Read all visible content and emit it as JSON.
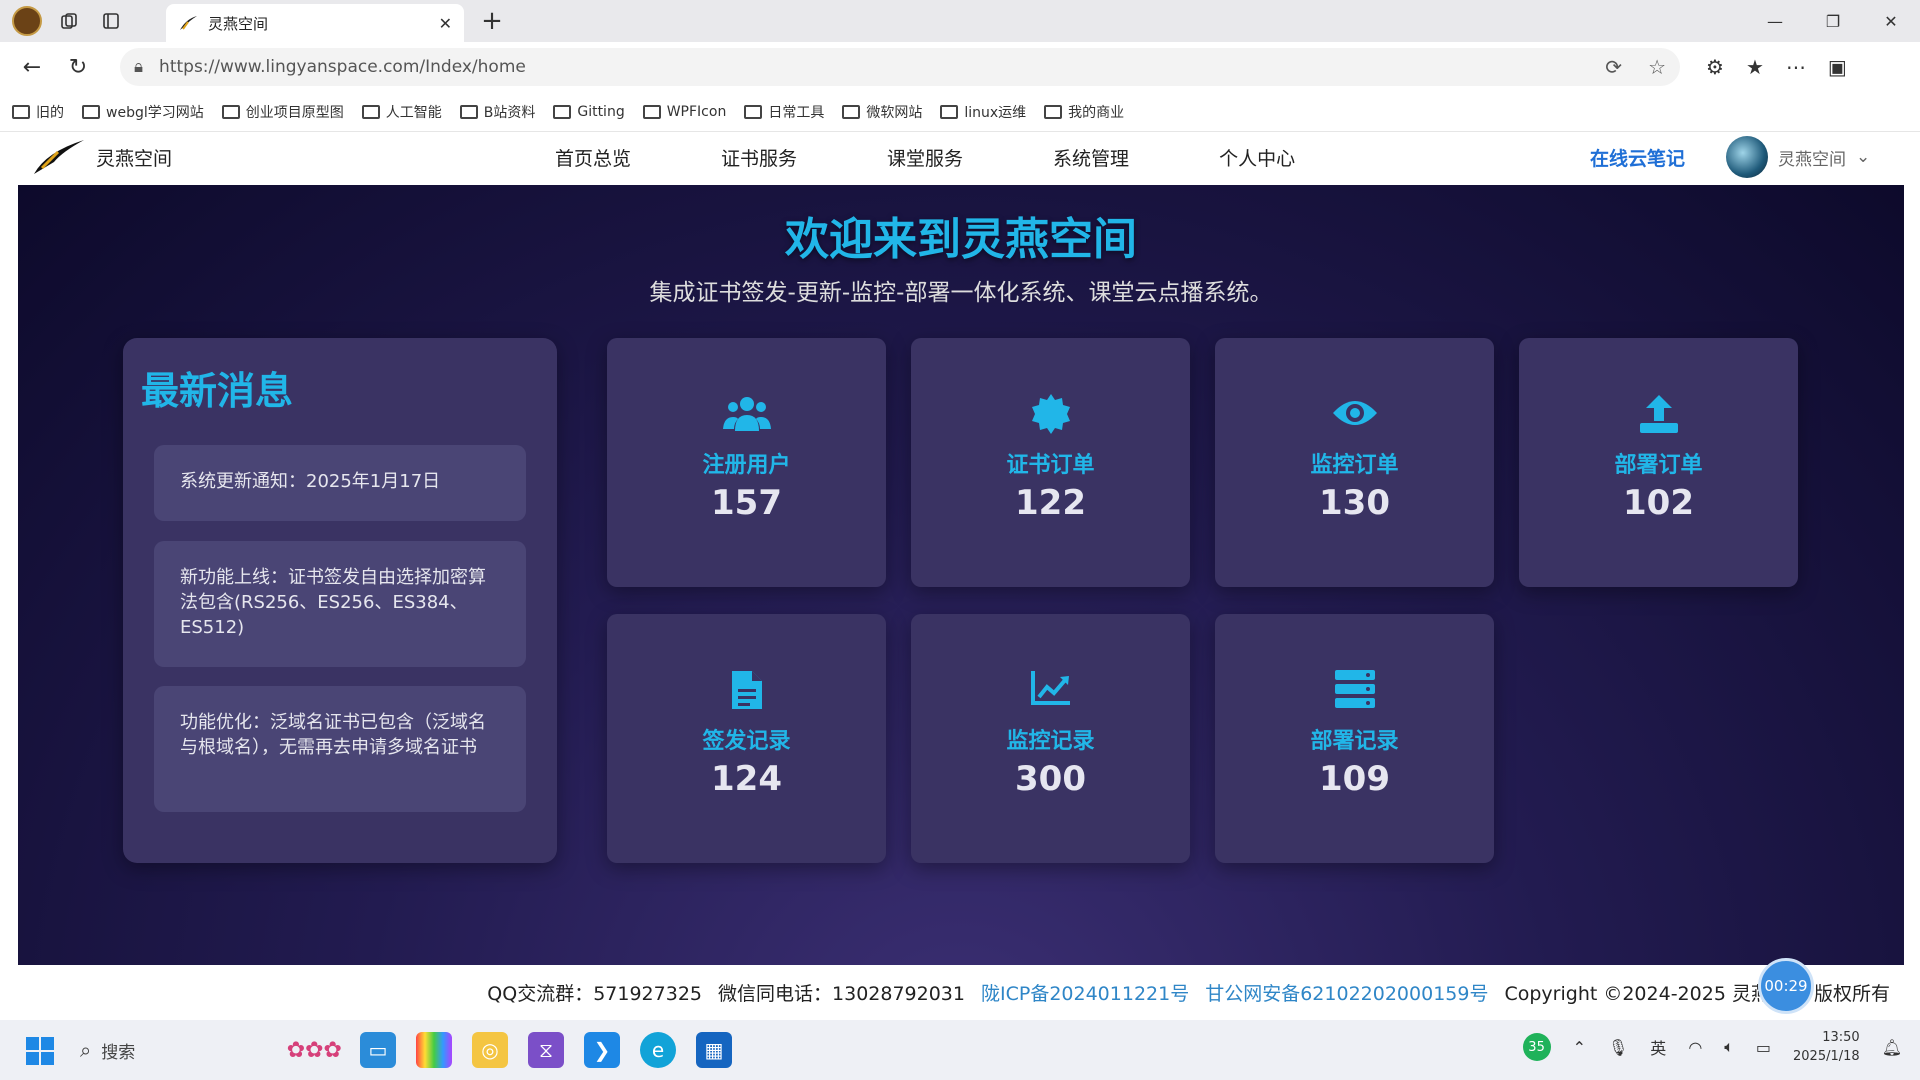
{
  "browser": {
    "tab_title": "灵燕空间",
    "url": "https://www.lingyanspace.com/Index/home"
  },
  "bookmarks": [
    "旧的",
    "webgl学习网站",
    "创业项目原型图",
    "人工智能",
    "B站资料",
    "Gitting",
    "WPFIcon",
    "日常工具",
    "微软网站",
    "linux运维",
    "我的商业"
  ],
  "site": {
    "logo_text": "灵燕空间",
    "nav": [
      "首页总览",
      "证书服务",
      "课堂服务",
      "系统管理",
      "个人中心"
    ],
    "cloud_note": "在线云笔记",
    "user_name": "灵燕空间"
  },
  "hero": {
    "title": "欢迎来到灵燕空间",
    "subtitle": "集成证书签发-更新-监控-部署一体化系统、课堂云点播系统。"
  },
  "news": {
    "title": "最新消息",
    "items": [
      "系统更新通知：2025年1月17日",
      "新功能上线：证书签发自由选择加密算法包含(RS256、ES256、ES384、ES512)",
      "功能优化：泛域名证书已包含（泛域名与根域名），无需再去申请多域名证书"
    ]
  },
  "stats": [
    {
      "label": "注册用户",
      "value": "157",
      "icon": "users-icon"
    },
    {
      "label": "证书订单",
      "value": "122",
      "icon": "certificate-icon"
    },
    {
      "label": "监控订单",
      "value": "130",
      "icon": "eye-icon"
    },
    {
      "label": "部署订单",
      "value": "102",
      "icon": "upload-icon"
    },
    {
      "label": "签发记录",
      "value": "124",
      "icon": "file-icon"
    },
    {
      "label": "监控记录",
      "value": "300",
      "icon": "chart-icon"
    },
    {
      "label": "部署记录",
      "value": "109",
      "icon": "server-icon"
    }
  ],
  "footer": {
    "qq": "QQ交流群：571927325",
    "wechat": "微信同电话：13028792031",
    "icp": "陇ICP备2024011221号",
    "police": "甘公网安备62102202000159号",
    "copyright": "Copyright ©2024-2025 灵燕空间 版权所有",
    "timer": "00:29"
  },
  "taskbar": {
    "search_placeholder": "搜索",
    "badge": "35",
    "ime": "英",
    "time": "13:50",
    "date": "2025/1/18"
  },
  "colors": {
    "accent": "#21b6e8",
    "card": "#3a3363",
    "bg_dark": "#0d0a2b"
  }
}
